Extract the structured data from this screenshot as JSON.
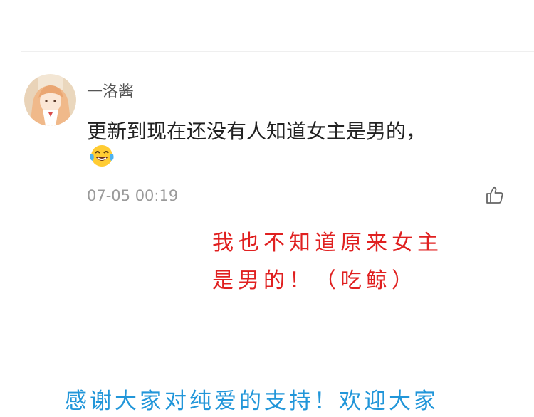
{
  "comment": {
    "username": "一洛酱",
    "text": "更新到现在还没有人知道女主是男的，",
    "emoji": "laughing-tears-emoji",
    "timestamp": "07-05 00:19",
    "like_icon": "thumbs-up-icon"
  },
  "annotations": {
    "red_line1": "我也不知道原来女主",
    "red_line2": "是男的！（吃鲸）",
    "red_color": "#e02020",
    "blue_line": "感谢大家对纯爱的支持！欢迎大家",
    "blue_color": "#2196d9"
  }
}
